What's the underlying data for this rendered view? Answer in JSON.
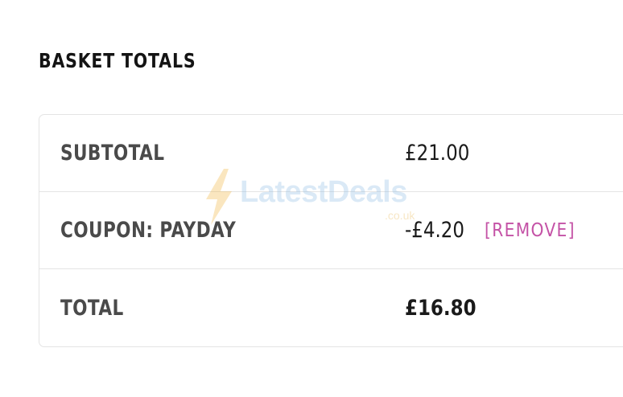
{
  "basket": {
    "heading": "BASKET TOTALS",
    "rows": [
      {
        "label": "SUBTOTAL",
        "value": "£21.00"
      },
      {
        "label": "COUPON: PAYDAY",
        "value": "-£4.20",
        "action": "[REMOVE]"
      },
      {
        "label": "TOTAL",
        "value": "£16.80"
      }
    ]
  },
  "watermark": {
    "brand": "LatestDeals",
    "domain": ".co.uk",
    "icon": "lightning-bolt-icon"
  },
  "colors": {
    "accent_link": "#c452a6",
    "text_dark": "#141414",
    "label_gray": "#4a4a4a",
    "border": "#e4e4e4"
  }
}
